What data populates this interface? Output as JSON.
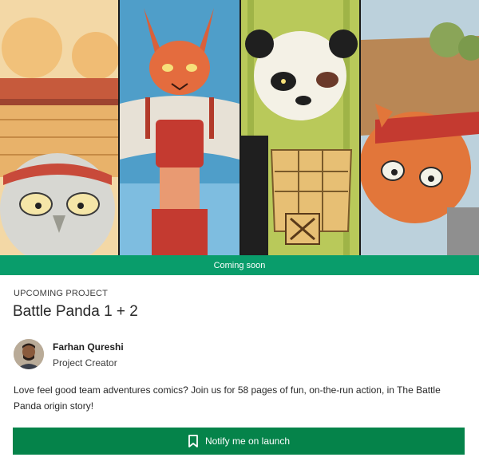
{
  "banner": {
    "status_label": "Coming soon"
  },
  "project": {
    "eyebrow": "UPCOMING PROJECT",
    "title": "Battle Panda 1 + 2",
    "creator_name": "Farhan Qureshi",
    "creator_role": "Project Creator",
    "description": "Love feel good team adventures comics? Join us for 58 pages of fun, on-the-run action, in The Battle Panda origin story!"
  },
  "actions": {
    "notify_label": "Notify me on launch",
    "notify_icon": "bookmark-icon"
  },
  "colors": {
    "banner_green": "#099d6b",
    "button_green": "#05834a",
    "text": "#282828"
  }
}
